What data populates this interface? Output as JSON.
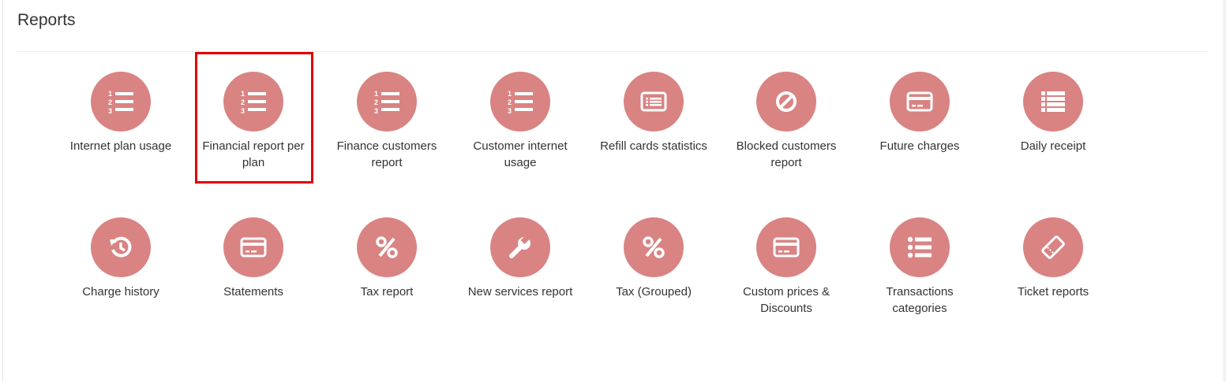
{
  "page": {
    "title": "Reports"
  },
  "reports": [
    {
      "label": "Internet plan usage",
      "icon": "numbered-list-icon"
    },
    {
      "label": "Financial report per plan",
      "icon": "numbered-list-icon"
    },
    {
      "label": "Finance customers report",
      "icon": "numbered-list-icon"
    },
    {
      "label": "Customer internet usage",
      "icon": "numbered-list-icon"
    },
    {
      "label": "Refill cards statistics",
      "icon": "list-alt-icon"
    },
    {
      "label": "Blocked customers report",
      "icon": "ban-icon"
    },
    {
      "label": "Future charges",
      "icon": "credit-card-icon"
    },
    {
      "label": "Daily receipt",
      "icon": "list-icon"
    },
    {
      "label": "Charge history",
      "icon": "history-icon"
    },
    {
      "label": "Statements",
      "icon": "credit-card-icon"
    },
    {
      "label": "Tax report",
      "icon": "percent-icon"
    },
    {
      "label": "New services report",
      "icon": "wrench-icon"
    },
    {
      "label": "Tax (Grouped)",
      "icon": "percent-icon"
    },
    {
      "label": "Custom prices & Discounts",
      "icon": "credit-card-icon"
    },
    {
      "label": "Transactions categories",
      "icon": "list-ul-icon"
    },
    {
      "label": "Ticket reports",
      "icon": "ticket-icon"
    }
  ],
  "colors": {
    "icon_circle": "#d98383",
    "highlight_border": "#e00000"
  }
}
